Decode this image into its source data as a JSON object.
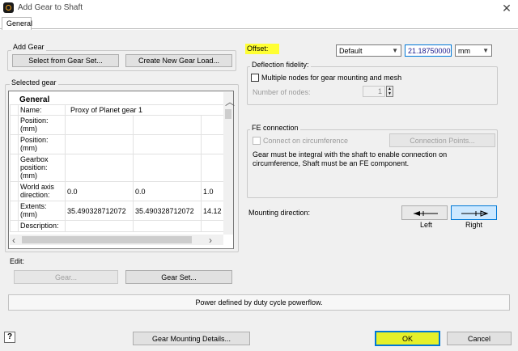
{
  "window": {
    "title": "Add Gear to Shaft",
    "close_glyph": "✕"
  },
  "tabs": [
    {
      "label": "General"
    }
  ],
  "add_gear": {
    "label": "Add Gear",
    "select_button": "Select from Gear Set...",
    "create_button": "Create New Gear Load..."
  },
  "selected_gear": {
    "label": "Selected gear",
    "section_title": "General",
    "rows": [
      {
        "label": "Name:",
        "values": [
          "Proxy of Planet gear 1"
        ]
      },
      {
        "label": "Position: (mm)",
        "values": [
          "",
          "",
          ""
        ]
      },
      {
        "label": "Position: (mm)",
        "values": [
          "",
          "",
          ""
        ]
      },
      {
        "label": "Gearbox position: (mm)",
        "values": [
          "",
          "",
          ""
        ]
      },
      {
        "label": "World axis direction:",
        "values": [
          "0.0",
          "0.0",
          "1.0"
        ]
      },
      {
        "label": "Extents: (mm)",
        "values": [
          "35.490328712072",
          "35.490328712072",
          "14.12"
        ]
      },
      {
        "label": "Description:",
        "values": [
          "",
          "",
          ""
        ]
      }
    ]
  },
  "edit": {
    "label": "Edit:",
    "gear_button": "Gear...",
    "gear_set_button": "Gear Set..."
  },
  "offset": {
    "label": "Offset:",
    "mode": "Default",
    "value": "21.18750000(",
    "unit": "mm",
    "highlight_color": "#ffff33"
  },
  "deflection": {
    "label": "Deflection fidelity:",
    "multiple_nodes_label": "Multiple nodes for gear mounting and mesh",
    "multiple_nodes_checked": false,
    "nodes_label": "Number of nodes:",
    "nodes_value": "1"
  },
  "fe_connection": {
    "label": "FE connection",
    "connect_label": "Connect on circumference",
    "connection_points_button": "Connection Points...",
    "message": "Gear must be integral with the shaft to enable connection on circumference, Shaft must be an FE component."
  },
  "mounting": {
    "label": "Mounting direction:",
    "left_label": "Left",
    "right_label": "Right",
    "selected": "Right"
  },
  "status_text": "Power defined by duty cycle powerflow.",
  "footer": {
    "help_glyph": "?",
    "details_button": "Gear Mounting Details...",
    "ok_button": "OK",
    "cancel_button": "Cancel",
    "ok_color": "#e5f02a",
    "accent_color": "#0078d7"
  }
}
